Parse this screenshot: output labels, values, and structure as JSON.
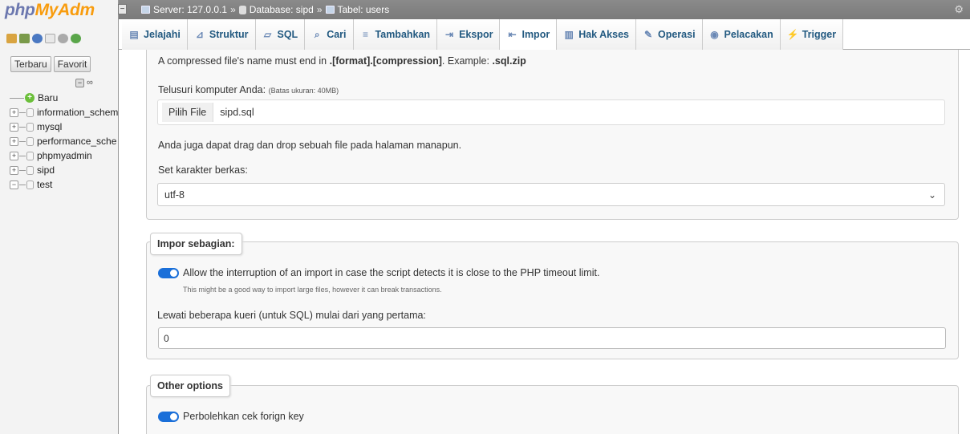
{
  "logo": {
    "part1": "php",
    "part2": "MyAdm"
  },
  "sidebar": {
    "tabs": [
      "Terbaru",
      "Favorit"
    ],
    "new_label": "Baru",
    "databases": [
      "information_schem",
      "mysql",
      "performance_sche",
      "phpmyadmin",
      "sipd",
      "test"
    ]
  },
  "breadcrumb": {
    "server": "Server: 127.0.0.1",
    "database": "Database: sipd",
    "table": "Tabel: users",
    "separator": "»"
  },
  "tabs": [
    {
      "label": "Jelajahi",
      "icon": "browse-icon"
    },
    {
      "label": "Struktur",
      "icon": "structure-icon"
    },
    {
      "label": "SQL",
      "icon": "sql-icon"
    },
    {
      "label": "Cari",
      "icon": "search-icon"
    },
    {
      "label": "Tambahkan",
      "icon": "insert-icon"
    },
    {
      "label": "Ekspor",
      "icon": "export-icon"
    },
    {
      "label": "Impor",
      "icon": "import-icon",
      "active": true
    },
    {
      "label": "Hak Akses",
      "icon": "privileges-icon"
    },
    {
      "label": "Operasi",
      "icon": "operations-icon"
    },
    {
      "label": "Pelacakan",
      "icon": "tracking-icon"
    },
    {
      "label": "Trigger",
      "icon": "trigger-icon"
    }
  ],
  "file_section": {
    "compressed_note_prefix": "A compressed file's name must end in ",
    "compressed_note_format": ".[format].[compression]",
    "compressed_note_mid": ". Example: ",
    "compressed_note_example": ".sql.zip",
    "browse_label": "Telusuri komputer Anda:",
    "max_size": "(Batas ukuran: 40MB)",
    "choose_file_button": "Pilih File",
    "file_name": "sipd.sql",
    "drag_drop_note": "Anda juga dapat drag dan drop sebuah file pada halaman manapun.",
    "charset_label": "Set karakter berkas:",
    "charset_value": "utf-8"
  },
  "partial_import": {
    "legend": "Impor sebagian:",
    "interrupt_label": "Allow the interruption of an import in case the script detects it is close to the PHP timeout limit.",
    "interrupt_note": "This might be a good way to import large files, however it can break transactions.",
    "interrupt_enabled": true,
    "skip_label": "Lewati beberapa kueri (untuk SQL) mulai dari yang pertama:",
    "skip_value": "0"
  },
  "other_options": {
    "legend": "Other options",
    "fk_check_label": "Perbolehkan cek forign key",
    "fk_check_enabled": true
  }
}
